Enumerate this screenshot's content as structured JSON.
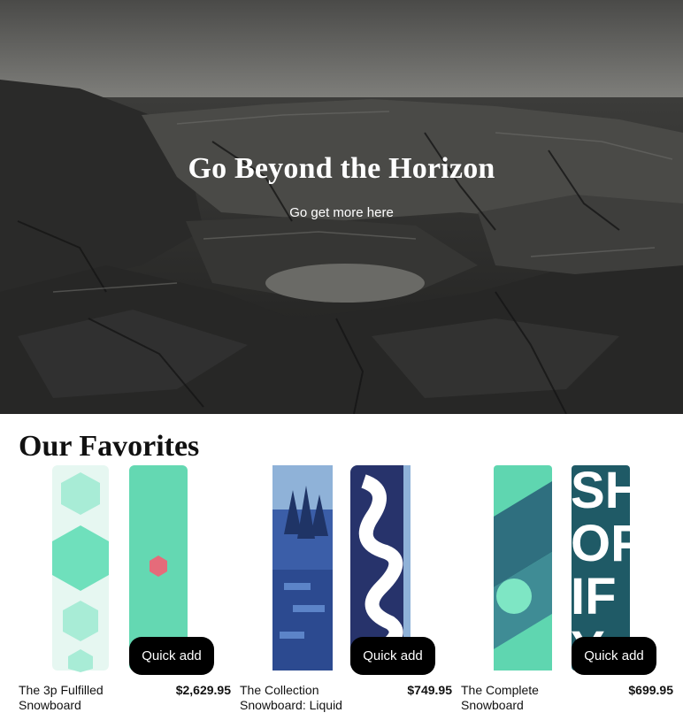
{
  "hero": {
    "title": "Go Beyond the Horizon",
    "subtitle": "Go get more here"
  },
  "favorites": {
    "title": "Our Favorites",
    "products": [
      {
        "name": "The 3p Fulfilled Snowboard",
        "price": "$2,629.95",
        "quick_add": "Quick add"
      },
      {
        "name": "The Collection Snowboard: Liquid",
        "price": "$749.95",
        "quick_add": "Quick add"
      },
      {
        "name": "The Complete Snowboard",
        "price": "$699.95",
        "quick_add": "Quick add"
      }
    ]
  },
  "colors": {
    "button_bg": "#000000",
    "button_text": "#ffffff",
    "mint": "#5fd6b0",
    "navy": "#27336b"
  }
}
